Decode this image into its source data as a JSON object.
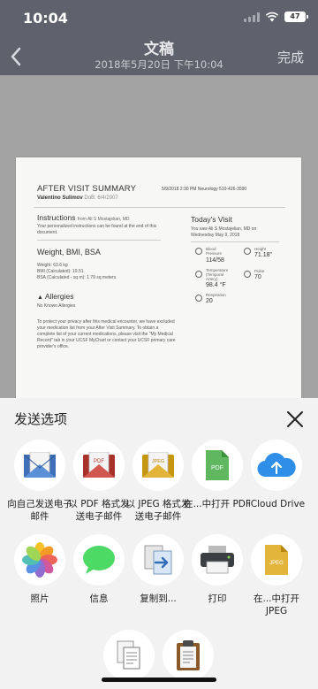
{
  "status_bar": {
    "time": "10:04",
    "battery": "47"
  },
  "nav": {
    "title": "文稿",
    "subtitle": "2018年5月20日 下午10:04",
    "done": "完成"
  },
  "document": {
    "title": "AFTER VISIT SUMMARY",
    "patient": "Valentino Sulimov",
    "dob": "DoB: 6/4/2007",
    "visit_meta": "5/9/2018  2:30 PM   Neurology 510-426-3590",
    "instructions_heading": "Instructions",
    "instructions_from": "from Ali S Mostajelian, MD",
    "instructions_text": [
      "Your personalized instructions can be found at the end of this",
      "document."
    ],
    "weight_heading": "Weight, BMI, BSA",
    "weight_lines": [
      "Weight: 63.6 kg",
      "BMI (Calculated): 19.51",
      "BSA (Calculated - sq m): 1.79 sq meters"
    ],
    "allergies_heading": "Allergies",
    "allergies_text": "No Known Allergies",
    "privacy_text": [
      "To protect your privacy after this medical encounter, we have excluded",
      "your medication list from your After Visit Summary. To obtain a",
      "complete list of your current medications, please visit the \"My Medical",
      "Record\" tab in your UCSF MyChart or contact your UCSF primary care",
      "provider's office."
    ],
    "today_heading": "Today's Visit",
    "today_text": [
      "You saw Ali S Mostajelian, MD on",
      "Wednesday May 9, 2018"
    ],
    "vitals": {
      "bp_label": [
        "Blood",
        "Pressure"
      ],
      "bp_value": "114/58",
      "height_label": "Height",
      "height_value": "71.18\"",
      "temp_label": [
        "Temperature",
        "(Temporal",
        "Artery)"
      ],
      "temp_value": "98.4 °F",
      "pulse_label": "Pulse",
      "pulse_value": "70",
      "resp_label": "Respiration",
      "resp_value": "20"
    }
  },
  "share_sheet": {
    "title": "发送选项",
    "apps_row1": [
      {
        "label": "向自己发送电子邮件",
        "icon": "mail-envelope-icon"
      },
      {
        "label": "以 PDF 格式发送电子邮件",
        "icon": "pdf-mail-icon"
      },
      {
        "label": "以 JPEG 格式发送电子邮件",
        "icon": "jpeg-mail-icon"
      },
      {
        "label": "在...中打开 PDF",
        "icon": "pdf-file-icon"
      },
      {
        "label": "iCloud Drive",
        "icon": "icloud-icon"
      }
    ],
    "apps_row2": [
      {
        "label": "照片",
        "icon": "photos-icon"
      },
      {
        "label": "信息",
        "icon": "messages-icon"
      },
      {
        "label": "复制到...",
        "icon": "copy-to-icon"
      },
      {
        "label": "打印",
        "icon": "printer-icon"
      },
      {
        "label": "在...中打开 JPEG",
        "icon": "jpeg-file-icon"
      }
    ],
    "apps_row3": [
      {
        "icon": "copy-document-icon"
      },
      {
        "icon": "clipboard-icon"
      }
    ]
  },
  "colors": {
    "nav_bg": "#5f626d",
    "sheet_bg": "#f2f2f2",
    "pdf_red": "#c0392b",
    "jpeg_gold": "#d4a017",
    "file_green": "#5fb85f",
    "icloud_blue": "#2f8fe8"
  }
}
